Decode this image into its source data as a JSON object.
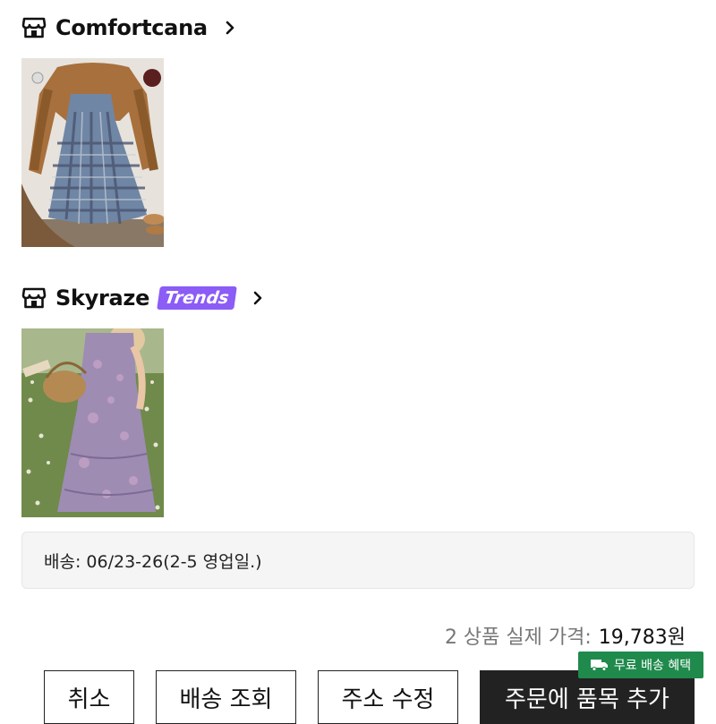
{
  "stores": [
    {
      "name": "Comfortcana",
      "badge": ""
    },
    {
      "name": "Skyraze",
      "badge": "Trends"
    }
  ],
  "delivery": {
    "text": "배송: 06/23-26(2-5 영업일.)"
  },
  "total": {
    "label": "2 상품 실제 가격:",
    "value": "19,783원"
  },
  "buttons": {
    "cancel": "취소",
    "track": "배송 조회",
    "edit_address": "주소 수정",
    "add_items": "주문에 품목 추가"
  },
  "free_shipping_tag": "무료 배송 혜택",
  "colors": {
    "trends_badge": "#8b5cf6",
    "free_ship": "#1f8a4c",
    "primary_button": "#222222"
  }
}
